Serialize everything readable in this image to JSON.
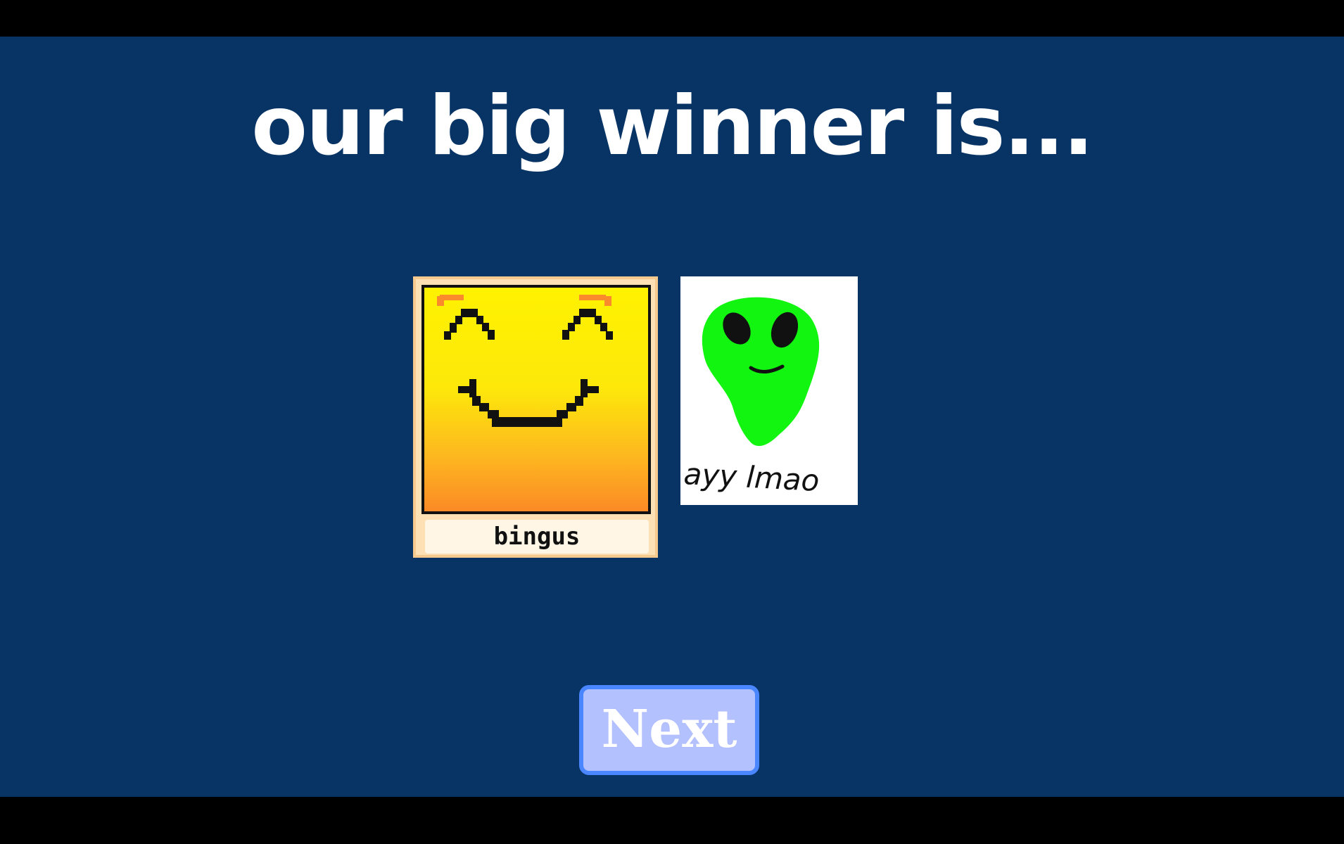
{
  "screen": {
    "title": "our big winner is..."
  },
  "entries": [
    {
      "type": "card",
      "label": "bingus",
      "art_icon": "smiling-face-icon"
    },
    {
      "type": "drawing",
      "caption": "ayy lmao",
      "art_icon": "alien-head-icon"
    }
  ],
  "next_button": {
    "label": "Next"
  },
  "colors": {
    "background": "#083465",
    "letterbox": "#000000",
    "title_text": "#ffffff",
    "card_frame": "#fde0b3",
    "card_label_bg": "#fff6e6",
    "button_fill": "#b4c1ff",
    "button_border": "#4a86ff",
    "alien_green": "#11f511"
  }
}
